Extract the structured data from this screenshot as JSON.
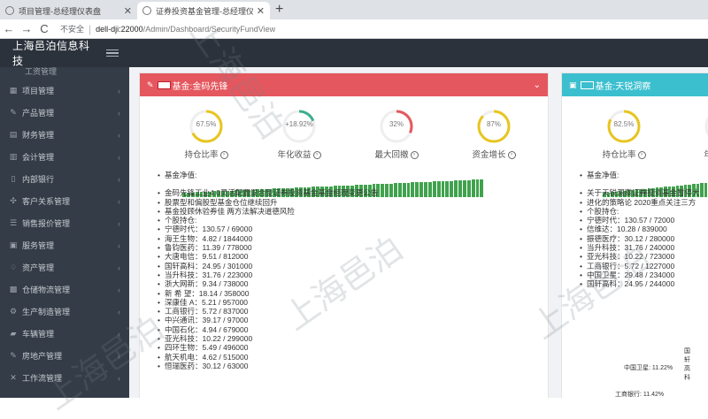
{
  "browser": {
    "tabs": [
      {
        "title": "项目管理-总经理仪表盘",
        "active": false
      },
      {
        "title": "证券投资基金管理-总经理仪表盘",
        "active": true
      }
    ],
    "new_tab": "+",
    "nav": {
      "back": "←",
      "forward": "→",
      "reload": "C"
    },
    "security_label": "不安全",
    "url_host": "dell-dji:22000",
    "url_path": "/Admin/Dashboard/SecurityFundView"
  },
  "app": {
    "brand": "上海邑泊信息科技"
  },
  "sidebar": {
    "partial_item": "工资管理",
    "items": [
      {
        "label": "项目管理",
        "icon": "project-icon"
      },
      {
        "label": "产品管理",
        "icon": "product-icon"
      },
      {
        "label": "财务管理",
        "icon": "finance-icon"
      },
      {
        "label": "会计管理",
        "icon": "accounting-icon"
      },
      {
        "label": "内部银行",
        "icon": "bank-icon"
      },
      {
        "label": "客户关系管理",
        "icon": "crm-icon"
      },
      {
        "label": "销售报价管理",
        "icon": "quote-icon"
      },
      {
        "label": "服务管理",
        "icon": "service-icon"
      },
      {
        "label": "资产管理",
        "icon": "asset-icon"
      },
      {
        "label": "仓储物流管理",
        "icon": "warehouse-icon"
      },
      {
        "label": "生产制造管理",
        "icon": "factory-icon"
      },
      {
        "label": "车辆管理",
        "icon": "car-icon"
      },
      {
        "label": "房地产管理",
        "icon": "realestate-icon"
      },
      {
        "label": "工作流管理",
        "icon": "workflow-icon"
      }
    ]
  },
  "panel1": {
    "title": "基金:金码先锋",
    "accent": "#e5575e",
    "gauges": [
      {
        "value": "67.5%",
        "label": "持仓比率",
        "fraction": 0.675,
        "color": "#e8c520"
      },
      {
        "value": "+18.92%",
        "label": "年化收益",
        "fraction": 0.1892,
        "color": "#3aaf8f"
      },
      {
        "value": "32%",
        "label": "最大回撤",
        "fraction": 0.32,
        "color": "#e5575e"
      },
      {
        "value": "87%",
        "label": "资金增长",
        "fraction": 0.87,
        "color": "#e8c520"
      }
    ],
    "nav_label": "基金净值:",
    "news": [
      "金码先锋工业4.0灵活配置混合型证券投资基金基金经理变更公告",
      "股票型和偏股型基金仓位继续回升",
      "基金投顾休验券佳 两方法解决道德风险"
    ],
    "holdings_label": "个股持仓:",
    "holdings": [
      "宁德时代：130.57 / 69000",
      "海王生物：4.82 / 1844000",
      "鲁钧医药：11.39 / 778000",
      "大唐电信：9.51 / 812000",
      "国轩高科：24.95 / 301000",
      "当升科技：31.76 / 223000",
      "浙大网新：9.34 / 738000",
      "新 希 望：18.14 / 358000",
      "深康佳 A：5.21 / 957000",
      "工商银行：5.72 / 837000",
      "中兴通讯：39.17 / 97000",
      "中国石化：4.94 / 679000",
      "亚光科技：10.22 / 299000",
      "四环生物：5.49 / 496000",
      "航天机电：4.62 / 515000",
      "恒瑞医药：30.12 / 63000"
    ]
  },
  "panel2": {
    "title": "基金:天锐洞察",
    "accent": "#3bbfcf",
    "gauges": [
      {
        "value": "82.5%",
        "label": "持仓比率",
        "fraction": 0.825,
        "color": "#e8c520"
      },
      {
        "value": "+",
        "label": "年化收",
        "fraction": 0.2,
        "color": "#3aaf8f"
      }
    ],
    "nav_label": "基金净值:",
    "news": [
      "关于天锐洞察证券投资基金暂停大",
      "进化的策略论 2020重点关注三方"
    ],
    "holdings_label": "个股持仓:",
    "holdings": [
      "宁德时代：130.57 / 72000",
      "信维达：10.28 / 839000",
      "振德医疗：30.12 / 280000",
      "当升科技：31.76 / 240000",
      "亚光科技：10.22 / 723000",
      "工商银行：5.72 / 1227000",
      "中国卫星：29.48 / 234000",
      "国轩高科：24.95 / 244000"
    ],
    "pie_labels": [
      "国轩高科",
      "中国卫星: 11.22%",
      "工商银行: 11.42%"
    ]
  },
  "watermark": "上海邑泊"
}
